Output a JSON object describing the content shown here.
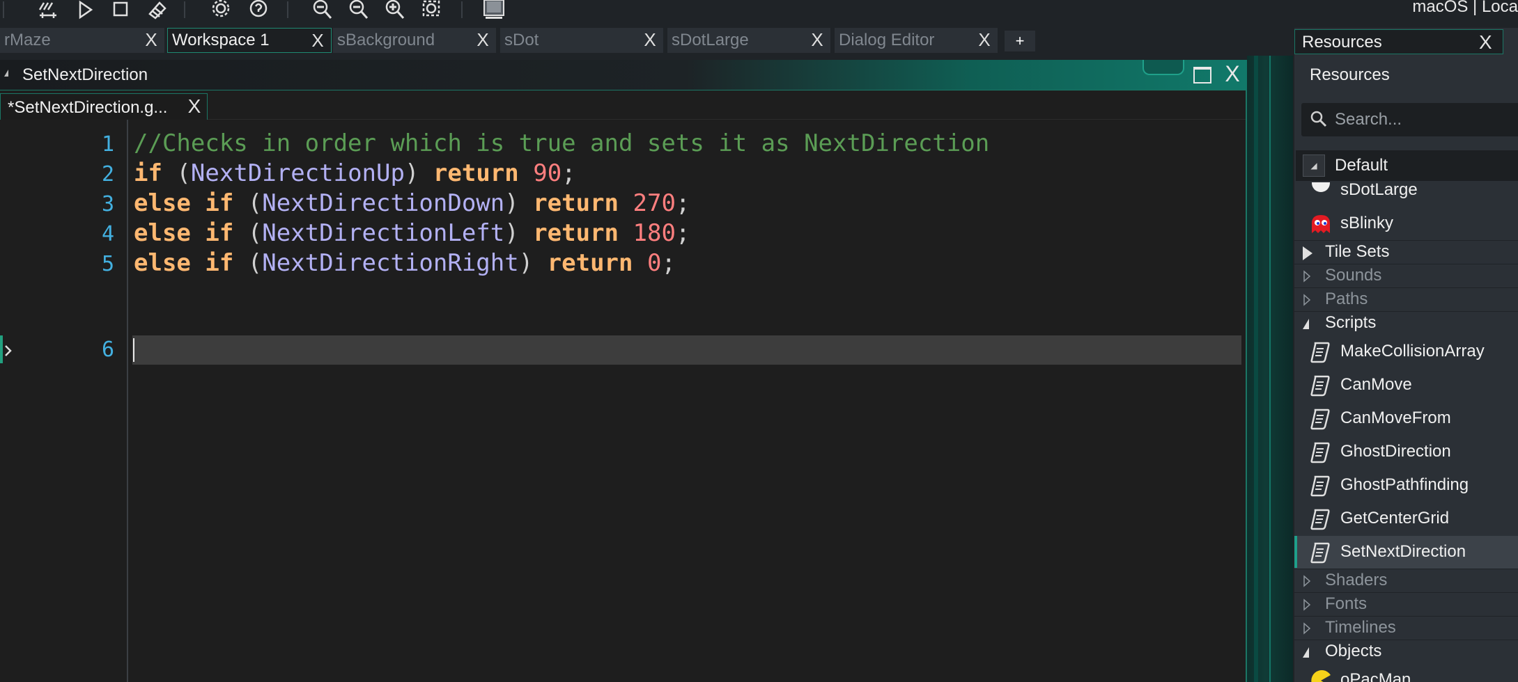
{
  "toolbar": {
    "platform_label": "macOS | Loca",
    "buttons": [
      "build-clean-icon",
      "run-icon",
      "stop-icon",
      "clean-icon",
      "settings-icon",
      "help-icon",
      "zoom-out-icon",
      "zoom-out-more-icon",
      "zoom-in-icon",
      "zoom-fit-icon",
      "monitor-icon"
    ]
  },
  "tabs": [
    {
      "label": "rMaze",
      "active": false
    },
    {
      "label": "Workspace 1",
      "active": true
    },
    {
      "label": "sBackground",
      "active": false
    },
    {
      "label": "sDot",
      "active": false
    },
    {
      "label": "sDotLarge",
      "active": false
    },
    {
      "label": "Dialog Editor",
      "active": false
    }
  ],
  "tab_add_label": "+",
  "tab_close_glyph": "X",
  "editor": {
    "window_title": "SetNextDirection",
    "file_tab": "*SetNextDirection.g...",
    "line_numbers": [
      "1",
      "2",
      "3",
      "4",
      "5",
      "6"
    ],
    "code": [
      [
        {
          "t": "//Checks in order which is true and sets it as NextDirection",
          "k": "com"
        }
      ],
      [
        {
          "t": "if",
          "k": "kw"
        },
        {
          "t": " (",
          "k": "punc"
        },
        {
          "t": "NextDirectionUp",
          "k": "var"
        },
        {
          "t": ") ",
          "k": "punc"
        },
        {
          "t": "return",
          "k": "kw"
        },
        {
          "t": " ",
          "k": "punc"
        },
        {
          "t": "90",
          "k": "num"
        },
        {
          "t": ";",
          "k": "punc"
        }
      ],
      [
        {
          "t": "else if",
          "k": "kw"
        },
        {
          "t": " (",
          "k": "punc"
        },
        {
          "t": "NextDirectionDown",
          "k": "var"
        },
        {
          "t": ") ",
          "k": "punc"
        },
        {
          "t": "return",
          "k": "kw"
        },
        {
          "t": " ",
          "k": "punc"
        },
        {
          "t": "270",
          "k": "num"
        },
        {
          "t": ";",
          "k": "punc"
        }
      ],
      [
        {
          "t": "else if",
          "k": "kw"
        },
        {
          "t": " (",
          "k": "punc"
        },
        {
          "t": "NextDirectionLeft",
          "k": "var"
        },
        {
          "t": ") ",
          "k": "punc"
        },
        {
          "t": "return",
          "k": "kw"
        },
        {
          "t": " ",
          "k": "punc"
        },
        {
          "t": "180",
          "k": "num"
        },
        {
          "t": ";",
          "k": "punc"
        }
      ],
      [
        {
          "t": "else if",
          "k": "kw"
        },
        {
          "t": " (",
          "k": "punc"
        },
        {
          "t": "NextDirectionRight",
          "k": "var"
        },
        {
          "t": ") ",
          "k": "punc"
        },
        {
          "t": "return",
          "k": "kw"
        },
        {
          "t": " ",
          "k": "punc"
        },
        {
          "t": "0",
          "k": "num"
        },
        {
          "t": ";",
          "k": "punc"
        }
      ],
      []
    ],
    "current_line": "6"
  },
  "resources": {
    "tab_label": "Resources",
    "header": "Resources",
    "search_placeholder": "Search...",
    "filter_label": "Default",
    "tree": [
      {
        "type": "item",
        "label": "sDotLarge",
        "icon": "sprite-dot-icon",
        "partial": true
      },
      {
        "type": "item",
        "label": "sBlinky",
        "icon": "ghost-sprite-icon"
      },
      {
        "type": "section",
        "label": "Tile Sets",
        "state": "collapsed",
        "dim": false
      },
      {
        "type": "section",
        "label": "Sounds",
        "state": "empty",
        "dim": true
      },
      {
        "type": "section",
        "label": "Paths",
        "state": "empty",
        "dim": true
      },
      {
        "type": "section",
        "label": "Scripts",
        "state": "expanded",
        "dim": false
      },
      {
        "type": "item",
        "label": "MakeCollisionArray",
        "icon": "script-icon"
      },
      {
        "type": "item",
        "label": "CanMove",
        "icon": "script-icon"
      },
      {
        "type": "item",
        "label": "CanMoveFrom",
        "icon": "script-icon"
      },
      {
        "type": "item",
        "label": "GhostDirection",
        "icon": "script-icon"
      },
      {
        "type": "item",
        "label": "GhostPathfinding",
        "icon": "script-icon"
      },
      {
        "type": "item",
        "label": "GetCenterGrid",
        "icon": "script-icon"
      },
      {
        "type": "item",
        "label": "SetNextDirection",
        "icon": "script-icon",
        "selected": true
      },
      {
        "type": "section",
        "label": "Shaders",
        "state": "empty",
        "dim": true
      },
      {
        "type": "section",
        "label": "Fonts",
        "state": "empty",
        "dim": true
      },
      {
        "type": "section",
        "label": "Timelines",
        "state": "empty",
        "dim": true
      },
      {
        "type": "section",
        "label": "Objects",
        "state": "expanded",
        "dim": false
      },
      {
        "type": "item",
        "label": "oPacMan",
        "icon": "pacman-object-icon"
      }
    ]
  },
  "colors": {
    "accent": "#1fa08a",
    "comment": "#5b9d55",
    "keyword": "#ffb871",
    "variable": "#b3b1f4",
    "number": "#ff7f7f",
    "line_number": "#43b0e0"
  }
}
